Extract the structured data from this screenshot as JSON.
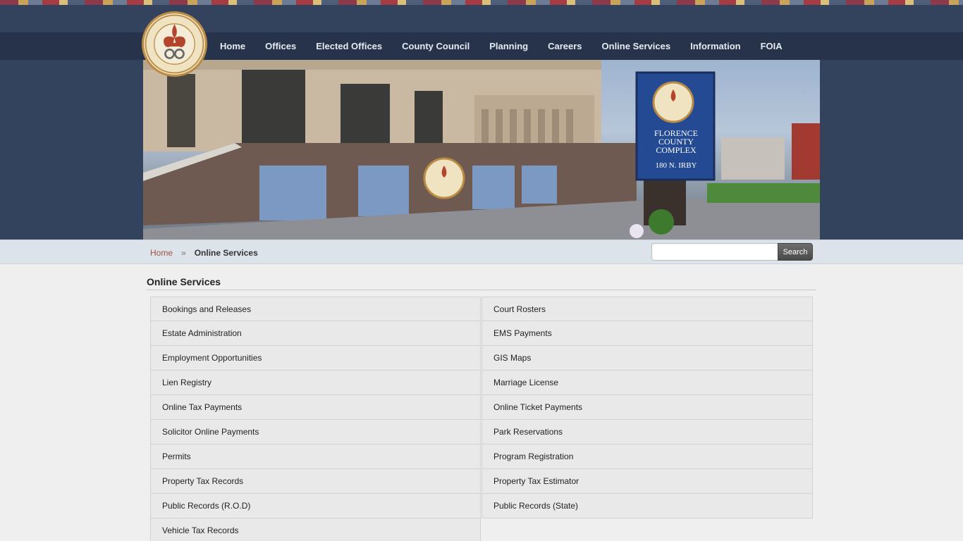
{
  "nav": {
    "items": [
      "Home",
      "Offices",
      "Elected Offices",
      "County Council",
      "Planning",
      "Careers",
      "Online Services",
      "Information",
      "FOIA"
    ]
  },
  "seal": {
    "text_top": "FLORENCE COUNTY",
    "text_bottom": "SOUTH CAROLINA",
    "year": "1888"
  },
  "banner": {
    "sign_line1": "FLORENCE",
    "sign_line2": "COUNTY",
    "sign_line3": "COMPLEX",
    "sign_address": "180 N. IRBY"
  },
  "breadcrumb": {
    "home": "Home",
    "separator": "»",
    "current": "Online Services"
  },
  "search": {
    "placeholder": "",
    "button_label": "Search"
  },
  "page_title": "Online Services",
  "services": [
    "Bookings and Releases",
    "Court Rosters",
    "Estate Administration",
    "EMS Payments",
    "Employment Opportunities",
    "GIS Maps",
    "Lien Registry",
    "Marriage License",
    "Online Tax Payments",
    "Online Ticket Payments",
    "Solicitor Online Payments",
    "Park Reservations",
    "Permits",
    "Program Registration",
    "Property Tax Records",
    "Property Tax Estimator",
    "Public Records (R.O.D)",
    "Public Records (State)",
    "Vehicle Tax Records"
  ],
  "colors": {
    "header": "#34435d",
    "navbar": "#26334a",
    "accent": "#a0523d"
  }
}
